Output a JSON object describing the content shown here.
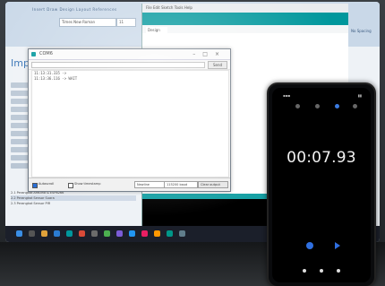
{
  "word": {
    "tabs": "Insert   Draw   Design   Layout   References",
    "font_name": "Times New Roman",
    "font_size": "11",
    "spacing_label": "No Spacing",
    "heading": "Implem",
    "outline_items": [
      "2.1 Perangkat Arduino & ESP8266",
      "2.2 Perangkat Sensor Suara",
      "2.3 Perangkat Sensor PIR"
    ]
  },
  "ide": {
    "menu": "File  Edit  Sketch  Tools  Help",
    "tab_label": "Design"
  },
  "serial": {
    "title": "COM6",
    "send_label": "Send",
    "lines": [
      "11:13:31.335 -> ",
      "11:13:36.116 -> WAIT"
    ],
    "autoscroll_label": "Autoscroll",
    "timestamp_label": "Show timestamp",
    "newline_option": "Newline",
    "baud_option": "115200 baud",
    "clear_label": "Clear output"
  },
  "phone": {
    "timer": "00:07.93"
  },
  "colors": {
    "arduino_teal": "#00979c",
    "word_blue": "#2f6fb3",
    "phone_accent": "#2f6fe0"
  }
}
